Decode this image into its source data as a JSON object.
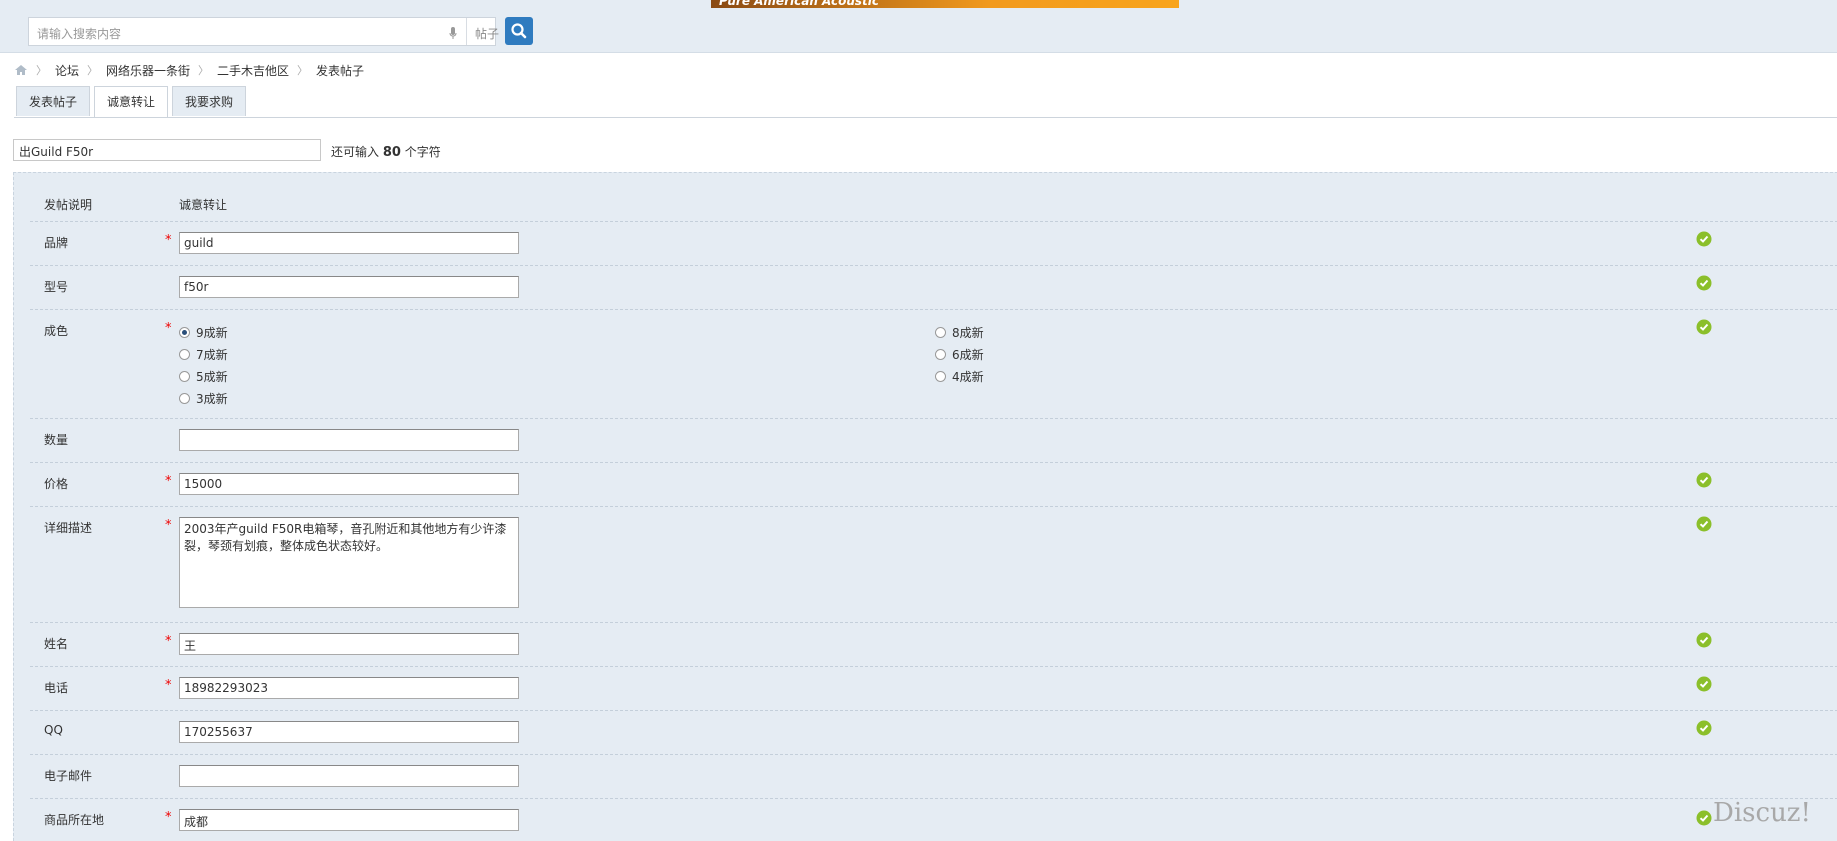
{
  "banner": {
    "text": "Pure American Acoustic"
  },
  "search": {
    "placeholder": "请输入搜索内容",
    "scope": "帖子"
  },
  "breadcrumb": [
    "论坛",
    "网络乐器一条街",
    "二手木吉他区",
    "发表帖子"
  ],
  "tabs": [
    "发表帖子",
    "诚意转让",
    "我要求购"
  ],
  "subject": {
    "value": "出Guild F50r",
    "hint_prefix": "还可输入",
    "hint_count": "80",
    "hint_suffix": "个字符"
  },
  "form": {
    "intro_label": "发帖说明",
    "intro_value": "诚意转让",
    "brand_label": "品牌",
    "brand_value": "guild",
    "model_label": "型号",
    "model_value": "f50r",
    "condition_label": "成色",
    "condition_options": [
      "9成新",
      "8成新",
      "7成新",
      "6成新",
      "5成新",
      "4成新",
      "3成新"
    ],
    "condition_selected": "9成新",
    "quantity_label": "数量",
    "quantity_value": "",
    "price_label": "价格",
    "price_value": "15000",
    "desc_label": "详细描述",
    "desc_value": "2003年产guild F50R电箱琴，音孔附近和其他地方有少许漆裂，琴颈有划痕，整体成色状态较好。",
    "name_label": "姓名",
    "name_value": "王",
    "phone_label": "电话",
    "phone_value": "18982293023",
    "qq_label": "QQ",
    "qq_value": "170255637",
    "email_label": "电子邮件",
    "email_value": "",
    "location_label": "商品所在地",
    "location_value": "成都",
    "required_mark": "*"
  },
  "watermark": "Discuz!"
}
